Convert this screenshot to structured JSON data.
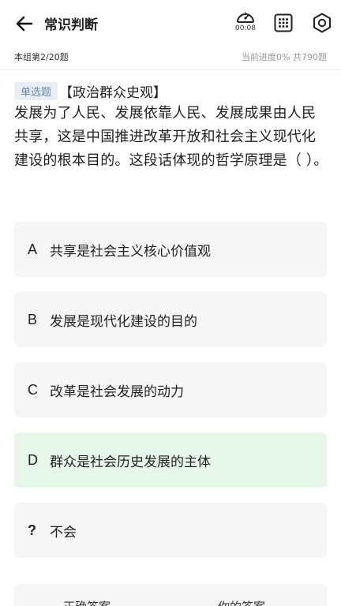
{
  "header": {
    "title": "常识判断",
    "timer": "00:08"
  },
  "subheader": {
    "group_progress": "本组第2/20题",
    "progress_info": "当前进度0%  共790题"
  },
  "question": {
    "type": "单选题",
    "category": "【政治群众史观】",
    "text": "发展为了人民、发展依靠人民、发展成果由人民共享，这是中国推进改革开放和社会主义现代化建设的根本目的。这段话体现的哲学原理是（ ）。"
  },
  "options": [
    {
      "letter": "A",
      "text": "共享是社会主义核心价值观"
    },
    {
      "letter": "B",
      "text": "发展是现代化建设的目的"
    },
    {
      "letter": "C",
      "text": "改革是社会发展的动力"
    },
    {
      "letter": "D",
      "text": "群众是社会历史发展的主体",
      "selected": true
    },
    {
      "letter": "?",
      "text": "不会"
    }
  ],
  "answer_bar": {
    "correct_label": "正确答案",
    "yours_label": "你的答案"
  },
  "colors": {
    "selected_bg": "#e6f7ea",
    "option_bg": "#f6f6f6",
    "tag_bg": "#e8eef5",
    "tag_text": "#6f8aa3"
  }
}
